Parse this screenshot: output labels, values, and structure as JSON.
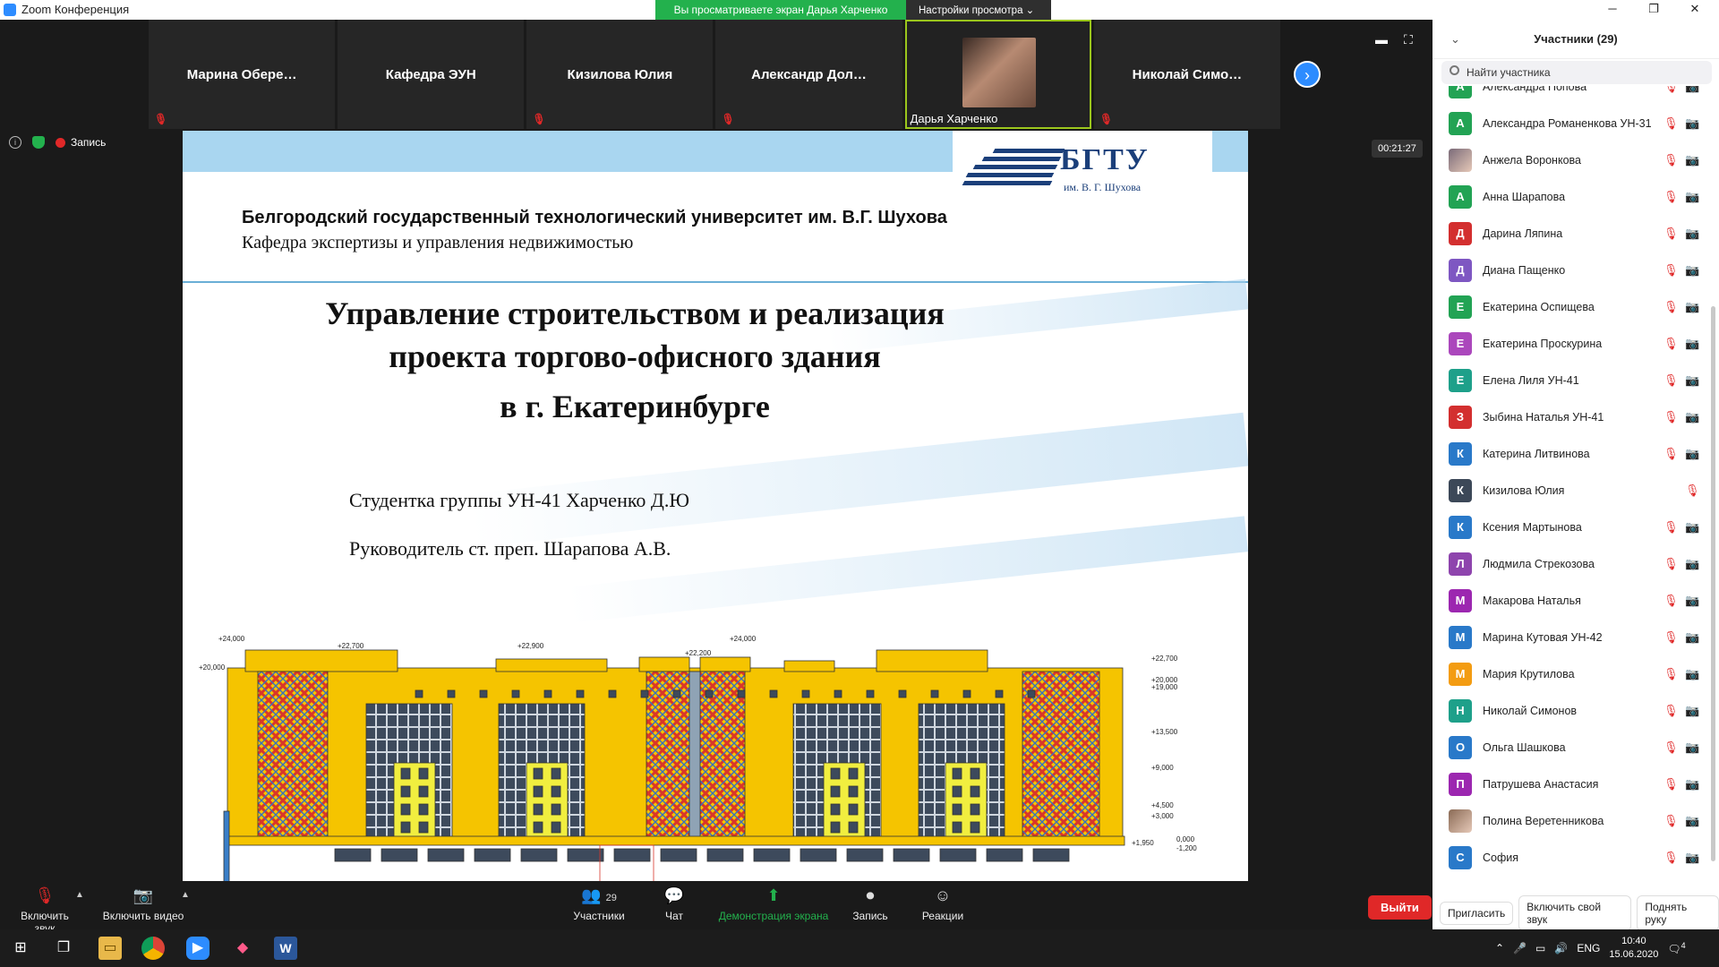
{
  "window": {
    "title": "Zoom Конференция",
    "minimize": "─",
    "maximize": "❐",
    "close": "✕"
  },
  "banner": {
    "viewing": "Вы просматриваете экран Дарья Харченко",
    "view_options": "Настройки просмотра ⌄"
  },
  "thumbs": [
    {
      "name": "Марина  Обере…",
      "muted": true
    },
    {
      "name": "Кафедра ЭУН",
      "muted": false
    },
    {
      "name": "Кизилова Юлия",
      "muted": true
    },
    {
      "name": "Александр  Дол…",
      "muted": true
    },
    {
      "name": "Дарья Харченко",
      "muted": false,
      "active": true
    },
    {
      "name": "Николай  Симо…",
      "muted": true
    }
  ],
  "stage": {
    "record_label": "Запись",
    "timer": "00:21:27",
    "info_icon": "i"
  },
  "slide": {
    "logo_name": "БГТУ",
    "logo_sub": "им. В. Г. Шухова",
    "university": "Белгородский государственный технологический университет им. В.Г. Шухова",
    "department": "Кафедра экспертизы и управления недвижимостью",
    "title_lines": [
      "Управление строительством и реализация",
      "проекта торгово-офисного здания",
      "в г. Екатеринбурге"
    ],
    "student": "Студентка группы УН-41 Харченко Д.Ю",
    "advisor": "Руководитель ст. преп. Шарапова А.В.",
    "elev_left": [
      "+24,000",
      "+22,700",
      "+20,000",
      "+22,900",
      "+22,200",
      "+24,000"
    ],
    "elev_right": [
      "+22,700",
      "+20,000",
      "+19,000",
      "+13,500",
      "+9,000",
      "+4,500",
      "+3,000",
      "0,000",
      "-1,200",
      "+1,950"
    ],
    "colors": {
      "facade": "#f5c400",
      "lattice": "#d8362b",
      "glass": "#3d4a5c",
      "window_yellow": "#f1ee3f",
      "band": "#3a7fc8"
    }
  },
  "participants_panel": {
    "title": "Участники (29)",
    "search_placeholder": "Найти участника",
    "list": [
      {
        "initial": "А",
        "name": "Александра Попова",
        "color": "#22a354"
      },
      {
        "initial": "А",
        "name": "Александра Романенкова УН-31",
        "color": "#22a354"
      },
      {
        "initial": "",
        "name": "Анжела Воронкова",
        "color": "#7a6a78",
        "photo": true
      },
      {
        "initial": "А",
        "name": "Анна Шарапова",
        "color": "#22a354"
      },
      {
        "initial": "Д",
        "name": "Дарина Ляпина",
        "color": "#d32f2f"
      },
      {
        "initial": "Д",
        "name": "Диана Пащенко",
        "color": "#7e57c2"
      },
      {
        "initial": "Е",
        "name": "Екатерина Оспищева",
        "color": "#22a354"
      },
      {
        "initial": "Е",
        "name": "Екатерина Проскурина",
        "color": "#ab47bc"
      },
      {
        "initial": "Е",
        "name": "Елена Лиля УН-41",
        "color": "#1ea08a"
      },
      {
        "initial": "З",
        "name": "Зыбина Наталья УН-41",
        "color": "#d32f2f"
      },
      {
        "initial": "К",
        "name": "Катерина Литвинова",
        "color": "#2979c9"
      },
      {
        "initial": "К",
        "name": "Кизилова Юлия",
        "color": "#3c4858",
        "no_video_icon": true
      },
      {
        "initial": "К",
        "name": "Ксения Мартынова",
        "color": "#2979c9"
      },
      {
        "initial": "Л",
        "name": "Людмила Стрекозова",
        "color": "#8e44ad"
      },
      {
        "initial": "М",
        "name": "Макарова Наталья",
        "color": "#9c27b0"
      },
      {
        "initial": "М",
        "name": "Марина Кутовая УН-42",
        "color": "#2979c9"
      },
      {
        "initial": "М",
        "name": "Мария Крутилова",
        "color": "#f39c12"
      },
      {
        "initial": "Н",
        "name": "Николай Симонов",
        "color": "#1ea08a"
      },
      {
        "initial": "О",
        "name": "Ольга Шашкова",
        "color": "#2979c9"
      },
      {
        "initial": "П",
        "name": "Патрушева Анастасия",
        "color": "#9c27b0"
      },
      {
        "initial": "",
        "name": "Полина Веретенникова",
        "color": "#8a6a55",
        "photo": true
      },
      {
        "initial": "С",
        "name": "София",
        "color": "#2979c9"
      }
    ],
    "footer": {
      "invite": "Пригласить",
      "unmute_me": "Включить свой звук",
      "raise_hand": "Поднять руку"
    }
  },
  "toolbar": {
    "unmute": "Включить звук",
    "start_video": "Включить видео",
    "participants": "Участники",
    "participants_count": "29",
    "chat": "Чат",
    "share": "Демонстрация экрана",
    "record": "Запись",
    "reactions": "Реакции",
    "leave": "Выйти"
  },
  "taskbar": {
    "lang": "ENG",
    "time": "10:40",
    "date": "15.06.2020",
    "notif_count": "4"
  }
}
